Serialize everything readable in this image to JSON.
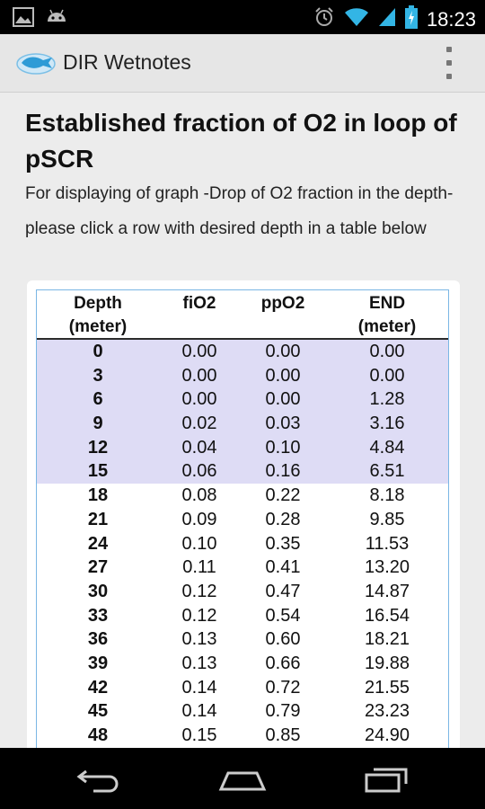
{
  "status_bar": {
    "time": "18:23",
    "icons": [
      "picture-icon",
      "android-icon",
      "alarm-icon",
      "wifi-icon",
      "signal-icon",
      "battery-charging-icon"
    ]
  },
  "action_bar": {
    "title": "DIR Wetnotes",
    "icon": "app-logo-icon",
    "menu_icon": "overflow-menu-icon"
  },
  "page": {
    "heading": "Established fraction of O2 in loop of pSCR",
    "description": "For displaying of graph -Drop of O2 fraction in the depth- please click a row with desired depth in a table below"
  },
  "table": {
    "headers": [
      {
        "line1": "Depth",
        "line2": "(meter)"
      },
      {
        "line1": "fiO2",
        "line2": ""
      },
      {
        "line1": "ppO2",
        "line2": ""
      },
      {
        "line1": "END",
        "line2": "(meter)"
      }
    ],
    "rows": [
      {
        "depth": "0",
        "fio2": "0.00",
        "ppo2": "0.00",
        "end": "0.00"
      },
      {
        "depth": "3",
        "fio2": "0.00",
        "ppo2": "0.00",
        "end": "0.00"
      },
      {
        "depth": "6",
        "fio2": "0.00",
        "ppo2": "0.00",
        "end": "1.28"
      },
      {
        "depth": "9",
        "fio2": "0.02",
        "ppo2": "0.03",
        "end": "3.16"
      },
      {
        "depth": "12",
        "fio2": "0.04",
        "ppo2": "0.10",
        "end": "4.84"
      },
      {
        "depth": "15",
        "fio2": "0.06",
        "ppo2": "0.16",
        "end": "6.51"
      },
      {
        "depth": "18",
        "fio2": "0.08",
        "ppo2": "0.22",
        "end": "8.18"
      },
      {
        "depth": "21",
        "fio2": "0.09",
        "ppo2": "0.28",
        "end": "9.85"
      },
      {
        "depth": "24",
        "fio2": "0.10",
        "ppo2": "0.35",
        "end": "11.53"
      },
      {
        "depth": "27",
        "fio2": "0.11",
        "ppo2": "0.41",
        "end": "13.20"
      },
      {
        "depth": "30",
        "fio2": "0.12",
        "ppo2": "0.47",
        "end": "14.87"
      },
      {
        "depth": "33",
        "fio2": "0.12",
        "ppo2": "0.54",
        "end": "16.54"
      },
      {
        "depth": "36",
        "fio2": "0.13",
        "ppo2": "0.60",
        "end": "18.21"
      },
      {
        "depth": "39",
        "fio2": "0.13",
        "ppo2": "0.66",
        "end": "19.88"
      },
      {
        "depth": "42",
        "fio2": "0.14",
        "ppo2": "0.72",
        "end": "21.55"
      },
      {
        "depth": "45",
        "fio2": "0.14",
        "ppo2": "0.79",
        "end": "23.23"
      },
      {
        "depth": "48",
        "fio2": "0.15",
        "ppo2": "0.85",
        "end": "24.90"
      }
    ],
    "highlight_color": "#dedcf5",
    "border_color": "#7ab6e4"
  },
  "nav_bar": {
    "buttons": [
      "back-icon",
      "home-icon",
      "recent-apps-icon"
    ]
  }
}
